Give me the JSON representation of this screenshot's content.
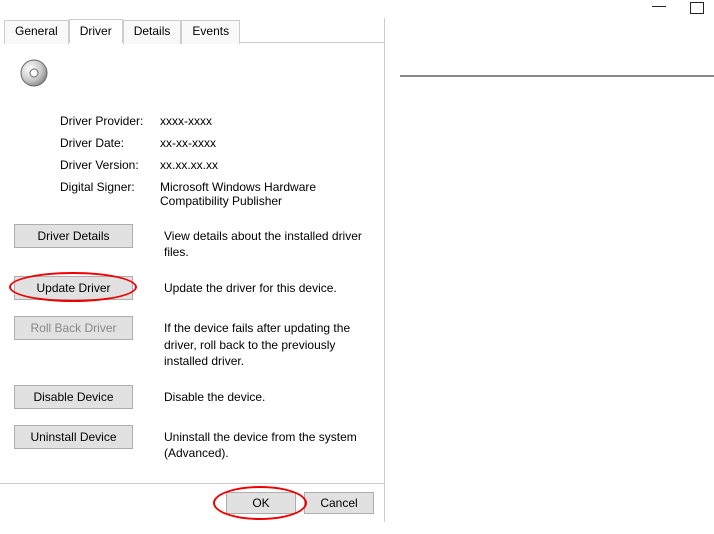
{
  "tabs": {
    "general": "General",
    "driver": "Driver",
    "details": "Details",
    "events": "Events"
  },
  "info": {
    "provider_label": "Driver Provider:",
    "provider_value": "xxxx-xxxx",
    "date_label": "Driver Date:",
    "date_value": "xx-xx-xxxx",
    "version_label": "Driver Version:",
    "version_value": "xx.xx.xx.xx",
    "signer_label": "Digital Signer:",
    "signer_value": "Microsoft Windows Hardware Compatibility Publisher"
  },
  "actions": {
    "details_btn": "Driver Details",
    "details_desc": "View details about the installed driver files.",
    "update_btn": "Update Driver",
    "update_desc": "Update the driver for this device.",
    "rollback_btn": "Roll Back Driver",
    "rollback_desc": "If the device fails after updating the driver, roll back to the previously installed driver.",
    "disable_btn": "Disable Device",
    "disable_desc": "Disable the device.",
    "uninstall_btn": "Uninstall Device",
    "uninstall_desc": "Uninstall the device from the system (Advanced)."
  },
  "footer": {
    "ok": "OK",
    "cancel": "Cancel"
  }
}
